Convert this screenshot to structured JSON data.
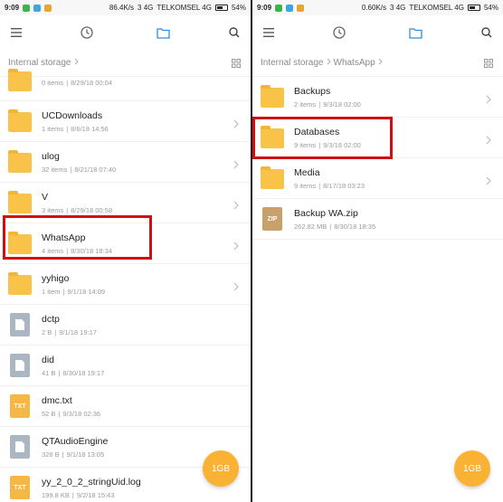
{
  "left": {
    "status": {
      "time": "9:09",
      "speed": "86.4K/s",
      "network": "3 4G",
      "carrier": "TELKOMSEL 4G",
      "battery": "54%"
    },
    "breadcrumb": [
      "Internal storage"
    ],
    "items": [
      {
        "type": "folder",
        "name": "",
        "count": "0 items",
        "date": "8/29/18 00:04"
      },
      {
        "type": "folder",
        "name": "UCDownloads",
        "count": "1 items",
        "date": "8/6/18 14:56"
      },
      {
        "type": "folder",
        "name": "ulog",
        "count": "32 items",
        "date": "8/21/18 07:40"
      },
      {
        "type": "folder",
        "name": "V",
        "count": "3 items",
        "date": "8/29/18 00:58"
      },
      {
        "type": "folder",
        "name": "WhatsApp",
        "count": "4 items",
        "date": "8/30/18 18:34"
      },
      {
        "type": "folder",
        "name": "yyhigo",
        "count": "1 item",
        "date": "9/1/18 14:09"
      },
      {
        "type": "file",
        "name": "dctp",
        "count": "2 B",
        "date": "9/1/18 19:17"
      },
      {
        "type": "file",
        "name": "did",
        "count": "41 B",
        "date": "8/30/18 19:17"
      },
      {
        "type": "txt",
        "name": "dmc.txt",
        "count": "52 B",
        "date": "9/3/18 02:36"
      },
      {
        "type": "file",
        "name": "QTAudioEngine",
        "count": "328 B",
        "date": "9/1/18 13:05"
      },
      {
        "type": "txt",
        "name": "yy_2_0_2_stringUid.log",
        "count": "199.8 KB",
        "date": "9/2/18 15:43"
      }
    ],
    "fab": "1GB"
  },
  "right": {
    "status": {
      "time": "9:09",
      "speed": "0.60K/s",
      "network": "3 4G",
      "carrier": "TELKOMSEL 4G",
      "battery": "54%"
    },
    "breadcrumb": [
      "Internal storage",
      "WhatsApp"
    ],
    "items": [
      {
        "type": "folder",
        "name": "Backups",
        "count": "2 items",
        "date": "9/3/18 02:00"
      },
      {
        "type": "folder",
        "name": "Databases",
        "count": "9 items",
        "date": "9/3/18 02:00"
      },
      {
        "type": "folder",
        "name": "Media",
        "count": "9 items",
        "date": "8/17/18 03:23"
      },
      {
        "type": "zip",
        "name": "Backup WA.zip",
        "count": "262.82 MB",
        "date": "8/30/18 18:35"
      }
    ],
    "fab": "1GB"
  },
  "icons": {
    "txt_label": "TXT",
    "zip_label": "ZIP"
  },
  "colors": {
    "accent": "#2c8ee6",
    "folder": "#f9c34a",
    "highlight": "#d01010",
    "fab": "#f9b233"
  }
}
